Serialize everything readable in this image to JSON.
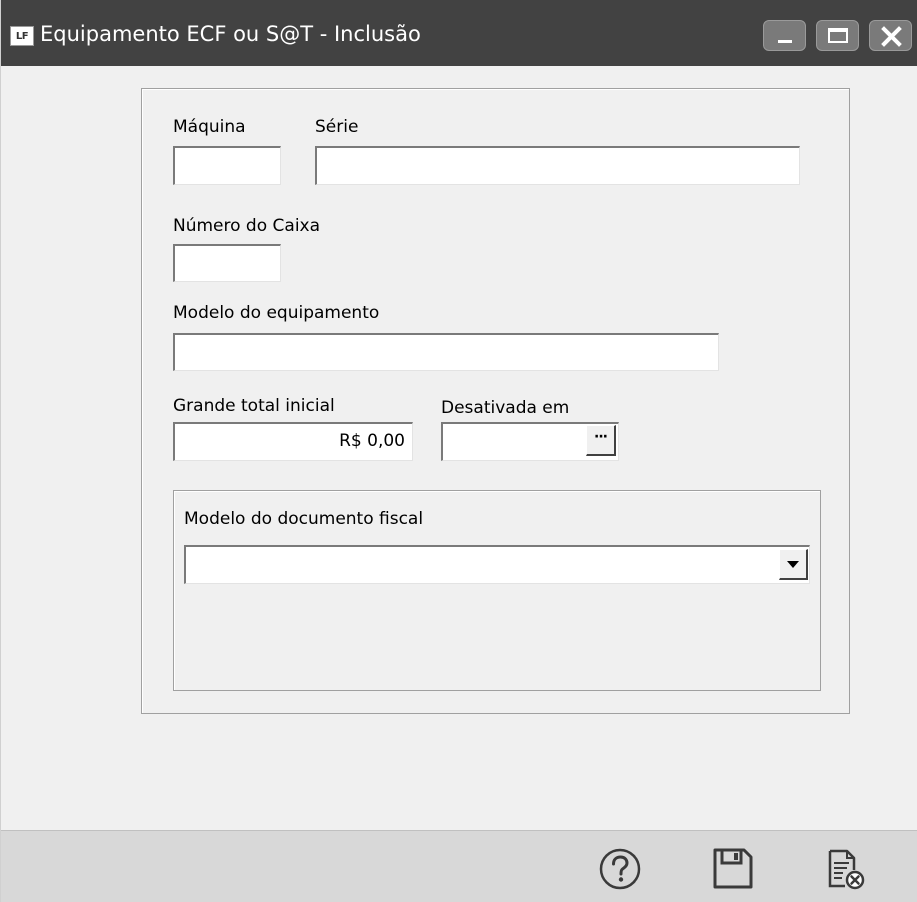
{
  "window": {
    "title": "Equipamento ECF ou S@T - Inclusão",
    "app_icon_text": "LF"
  },
  "form": {
    "maquina": {
      "label": "Máquina",
      "value": ""
    },
    "serie": {
      "label": "Série",
      "value": ""
    },
    "numero_caixa": {
      "label": "Número do Caixa",
      "value": ""
    },
    "modelo_equipamento": {
      "label": "Modelo do equipamento",
      "value": ""
    },
    "grande_total": {
      "label": "Grande total inicial",
      "value": "R$ 0,00"
    },
    "desativada_em": {
      "label": "Desativada em",
      "value": "",
      "button_label": "···"
    },
    "modelo_documento": {
      "label": "Modelo do documento fiscal",
      "selected": ""
    }
  },
  "toolbar": {
    "help_icon": "help-icon",
    "save_icon": "save-icon",
    "cancel_icon": "cancel-document-icon"
  }
}
